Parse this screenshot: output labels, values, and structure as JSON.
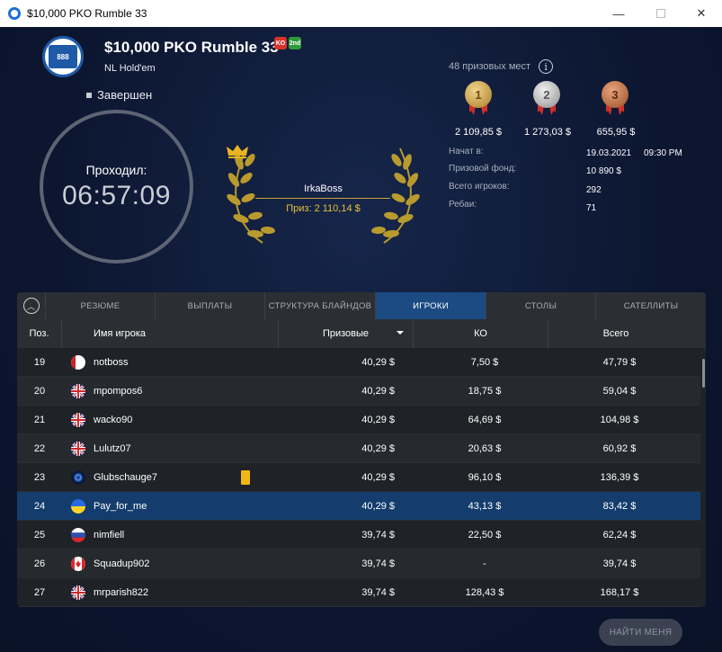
{
  "window": {
    "title": "$10,000 PKO Rumble 33"
  },
  "header": {
    "name": "$10,000 PKO Rumble 33",
    "game": "NL Hold'em",
    "status": "Завершен",
    "logo_text": "888",
    "badge_ko": "KO",
    "badge_second": "2nd"
  },
  "timer": {
    "label": "Проходил:",
    "value": "06:57:09"
  },
  "winner": {
    "name": "IrkaBoss",
    "prize": "Приз: 2 110,14 $"
  },
  "prizes": {
    "places_label": "48 призовых мест",
    "medals": [
      {
        "rank": "1",
        "amount": "2 109,85 $",
        "color": "#c9973a"
      },
      {
        "rank": "2",
        "amount": "1 273,03 $",
        "color": "#b7b7b7"
      },
      {
        "rank": "3",
        "amount": "655,95 $",
        "color": "#c06a3e"
      }
    ]
  },
  "info": [
    {
      "label": "Начат в:",
      "value": "19.03.2021",
      "extra": "09:30 PM"
    },
    {
      "label": "Призовой фонд:",
      "value": "10 890 $"
    },
    {
      "label": "Всего игроков:",
      "value": "292"
    },
    {
      "label": "Ребаи:",
      "value": "71"
    }
  ],
  "tabs": [
    "РЕЗЮМЕ",
    "ВЫПЛАТЫ",
    "СТРУКТУРА БЛАЙНДОВ",
    "ИГРОКИ",
    "СТОЛЫ",
    "САТЕЛЛИТЫ"
  ],
  "active_tab": "ИГРОКИ",
  "table": {
    "headers": {
      "pos": "Поз.",
      "name": "Имя игрока",
      "prize": "Призовые",
      "ko": "КО",
      "total": "Всего"
    },
    "rows": [
      {
        "pos": "19",
        "flag": "blank",
        "name": "notboss",
        "prize": "40,29 $",
        "ko": "7,50 $",
        "total": "47,79 $"
      },
      {
        "pos": "20",
        "flag": "uk",
        "name": "mpompos6",
        "prize": "40,29 $",
        "ko": "18,75 $",
        "total": "59,04 $"
      },
      {
        "pos": "21",
        "flag": "uk",
        "name": "wacko90",
        "prize": "40,29 $",
        "ko": "64,69 $",
        "total": "104,98 $"
      },
      {
        "pos": "22",
        "flag": "uk",
        "name": "Lulutz07",
        "prize": "40,29 $",
        "ko": "20,63 $",
        "total": "60,92 $"
      },
      {
        "pos": "23",
        "flag": "world",
        "name": "Glubschauge7",
        "prize": "40,29 $",
        "ko": "96,10 $",
        "total": "136,39 $",
        "note": true
      },
      {
        "pos": "24",
        "flag": "ukraine",
        "name": "Pay_for_me",
        "prize": "40,29 $",
        "ko": "43,13 $",
        "total": "83,42 $",
        "highlight": true
      },
      {
        "pos": "25",
        "flag": "russia",
        "name": "nimfiell",
        "prize": "39,74 $",
        "ko": "22,50 $",
        "total": "62,24 $"
      },
      {
        "pos": "26",
        "flag": "canada",
        "name": "Squadup902",
        "prize": "39,74 $",
        "ko": "-",
        "total": "39,74 $"
      },
      {
        "pos": "27",
        "flag": "uk",
        "name": "mrparish822",
        "prize": "39,74 $",
        "ko": "128,43 $",
        "total": "168,17 $"
      }
    ]
  },
  "find_me": "НАЙТИ МЕНЯ"
}
